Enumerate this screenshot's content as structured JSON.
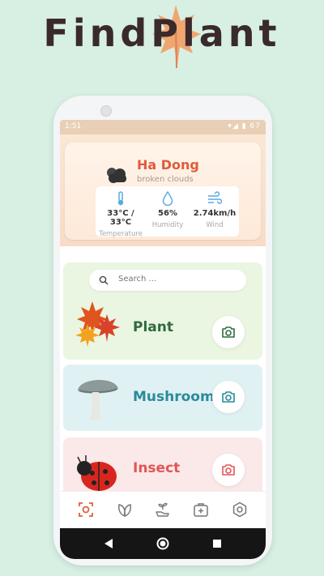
{
  "header": {
    "app_title": "FindPlant"
  },
  "statusbar": {
    "time": "1:51",
    "icons": "▾◢ ▮ 67"
  },
  "weather": {
    "city": "Ha Dong",
    "condition": "broken clouds",
    "temperature": {
      "value": "33°C / 33°C",
      "label": "Temperature"
    },
    "humidity": {
      "value": "56%",
      "label": "Humidity"
    },
    "wind": {
      "value": "2.74km/h",
      "label": "Wind"
    }
  },
  "search": {
    "placeholder": "Search ..."
  },
  "categories": [
    {
      "label": "Plant",
      "color": "#2e6b3f"
    },
    {
      "label": "Mushroom",
      "color": "#2a8a9a"
    },
    {
      "label": "Insect",
      "color": "#e05656"
    }
  ],
  "navbar": {
    "items": [
      "scan-icon",
      "leaves-icon",
      "plant-hand-icon",
      "first-aid-icon",
      "settings-icon"
    ],
    "active_color": "#e0603a"
  },
  "colors": {
    "background": "#d8f0e4",
    "accent": "#e05a3d"
  }
}
